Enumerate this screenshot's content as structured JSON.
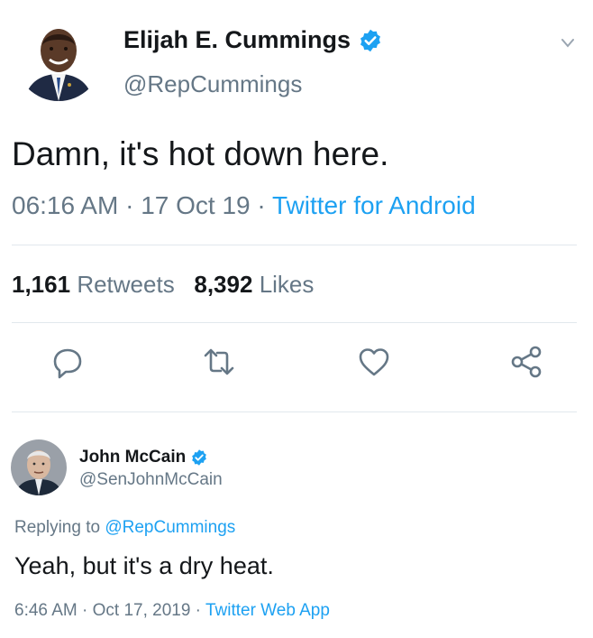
{
  "main_tweet": {
    "author_name": "Elijah E. Cummings",
    "handle": "@RepCummings",
    "text": "Damn, it's hot down here.",
    "time": "06:16 AM",
    "date": "17 Oct 19",
    "source": "Twitter for Android",
    "separator": " · ",
    "retweets_count": "1,161",
    "retweets_label": "Retweets",
    "likes_count": "8,392",
    "likes_label": "Likes"
  },
  "reply_tweet": {
    "author_name": "John McCain",
    "handle": "@SenJohnMcCain",
    "replying_prefix": "Replying to ",
    "replying_to": "@RepCummings",
    "text": "Yeah, but it's a dry heat.",
    "time": "6:46 AM",
    "date": "Oct 17, 2019",
    "source": "Twitter Web App",
    "separator": " · "
  },
  "icons": [
    "verified-badge-icon",
    "chevron-down-icon",
    "reply-icon",
    "retweet-icon",
    "like-icon",
    "share-icon"
  ],
  "colors": {
    "link_blue": "#1da1f2",
    "secondary_text": "#657786",
    "primary_text": "#14171a",
    "divider": "#e1e8ed"
  }
}
